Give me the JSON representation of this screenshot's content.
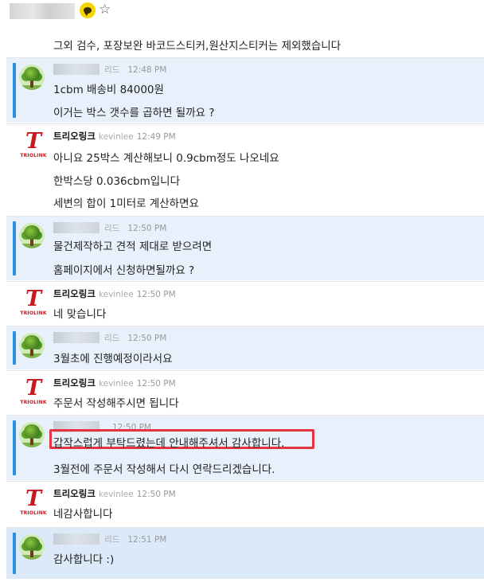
{
  "header": {
    "star_icon": "☆"
  },
  "continuation": "그외 검수, 포장보완 바코드스티커,원산지스티커는 제외했습니다",
  "brand_logo_text": "TRIOLINK",
  "messages": [
    {
      "sender_type": "user",
      "role": "리드",
      "time": "12:48 PM",
      "lines": [
        "1cbm 배송비 84000원",
        "이거는 박스 갯수를 곱하면 될까요 ?"
      ]
    },
    {
      "sender_type": "company",
      "name": "트리오링크",
      "user_id": "kevinlee",
      "time": "12:49 PM",
      "lines": [
        "아니요 25박스 계산해보니 0.9cbm정도 나오네요",
        "한박스당 0.036cbm입니다",
        "세변의 합이 1미터로 계산하면요"
      ]
    },
    {
      "sender_type": "user",
      "role": "리드",
      "time": "12:50 PM",
      "lines": [
        "물건제작하고 견적 제대로 받으려면",
        "홈페이지에서 신청하면될까요 ?"
      ]
    },
    {
      "sender_type": "company",
      "name": "트리오링크",
      "user_id": "kevinlee",
      "time": "12:50 PM",
      "lines": [
        "네 맞습니다"
      ]
    },
    {
      "sender_type": "user",
      "role": "리드",
      "time": "12:50 PM",
      "lines": [
        "3월초에 진행예정이라서요"
      ]
    },
    {
      "sender_type": "company",
      "name": "트리오링크",
      "user_id": "kevinlee",
      "time": "12:50 PM",
      "lines": [
        "주문서 작성해주시면 됩니다"
      ]
    },
    {
      "sender_type": "user",
      "role": "",
      "time": "12:50 PM",
      "lines": [
        "갑작스럽게 부탁드렸는데 안내해주셔서 감사합니다.",
        "3월전에 주문서 작성해서 다시 연락드리겠습니다."
      ]
    },
    {
      "sender_type": "company",
      "name": "트리오링크",
      "user_id": "kevinlee",
      "time": "12:50 PM",
      "lines": [
        "네감사합니다"
      ]
    },
    {
      "sender_type": "user",
      "role": "리드",
      "time": "12:51 PM",
      "lines": [
        "감사합니다 :)"
      ]
    }
  ]
}
